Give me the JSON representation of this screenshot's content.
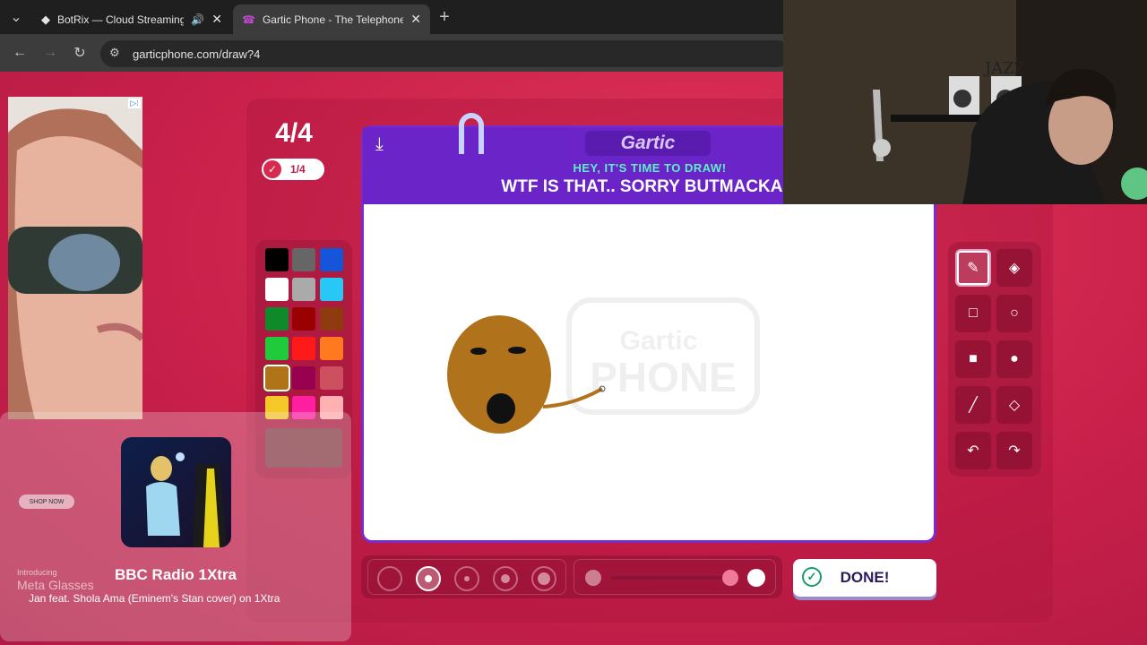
{
  "tabs": [
    {
      "title": "BotRix — Cloud Streaming",
      "icon": "botrix-icon"
    },
    {
      "title": "Gartic Phone - The Telephone G",
      "icon": "gartic-icon"
    }
  ],
  "url": "garticphone.com/draw?4",
  "round": {
    "big": "4/4",
    "small": "1/4"
  },
  "header": {
    "logo": "Gartic",
    "subtitle": "HEY, IT'S TIME TO DRAW!",
    "prompt": "WTF IS THAT.. SORRY BUTMACKA'S"
  },
  "watermark": {
    "line1": "Gartic",
    "line2": "PHONE"
  },
  "palette": [
    "#000000",
    "#666666",
    "#1455d9",
    "#ffffff",
    "#aaaaaa",
    "#27c8f5",
    "#0f8a2a",
    "#9a0000",
    "#8f3b10",
    "#1fcb3a",
    "#ff1a1a",
    "#ff7a1f",
    "#b07317",
    "#99004f",
    "#cc5060",
    "#f5c82a",
    "#ff1fa0",
    "#ffb0b0"
  ],
  "selected_color": "#b07317",
  "done_label": "DONE!",
  "ad": {
    "shop": "SHOP NOW",
    "intro": "Introducing",
    "brand": "Meta Glasses"
  },
  "media": {
    "title": "BBC Radio 1Xtra",
    "track": "Jan feat. Shola Ama (Eminem's Stan cover) on 1Xtra"
  },
  "cam": {
    "sign": "JAZZ"
  }
}
